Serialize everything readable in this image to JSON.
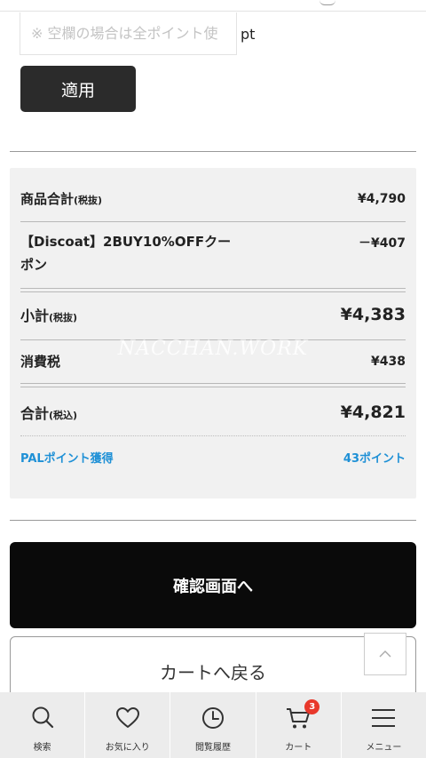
{
  "point_form": {
    "placeholder": "※ 空欄の場合は全ポイント使",
    "unit": "pt",
    "apply_label": "適用"
  },
  "summary": {
    "subtotal_items": {
      "label": "商品合計",
      "tax_note": "(税抜)",
      "value": "¥4,790"
    },
    "coupon": {
      "label": "【Discoat】2BUY10%OFFクーポン",
      "value": "－¥407"
    },
    "subtotal": {
      "label": "小計",
      "tax_note": "(税抜)",
      "value": "¥4,383"
    },
    "tax": {
      "label": "消費税",
      "value": "¥438"
    },
    "total": {
      "label": "合計",
      "tax_note": "(税込)",
      "value": "¥4,821"
    },
    "pal_points": {
      "label": "PALポイント獲得",
      "value": "43ポイント"
    }
  },
  "watermark": "NACCHAN.WORK",
  "actions": {
    "confirm_label": "確認画面へ",
    "back_label": "カートへ戻る"
  },
  "tabbar": {
    "items": [
      {
        "label": "検索",
        "icon": "search-icon"
      },
      {
        "label": "お気に入り",
        "icon": "heart-icon"
      },
      {
        "label": "閲覧履歴",
        "icon": "clock-icon"
      },
      {
        "label": "カート",
        "icon": "cart-icon",
        "badge": "3"
      },
      {
        "label": "メニュー",
        "icon": "menu-icon"
      }
    ]
  },
  "colors": {
    "accent_blue": "#1e90d6",
    "badge_red": "#e8382b",
    "confirm_bg": "#0a0a0a",
    "apply_bg": "#2b2b2b"
  }
}
